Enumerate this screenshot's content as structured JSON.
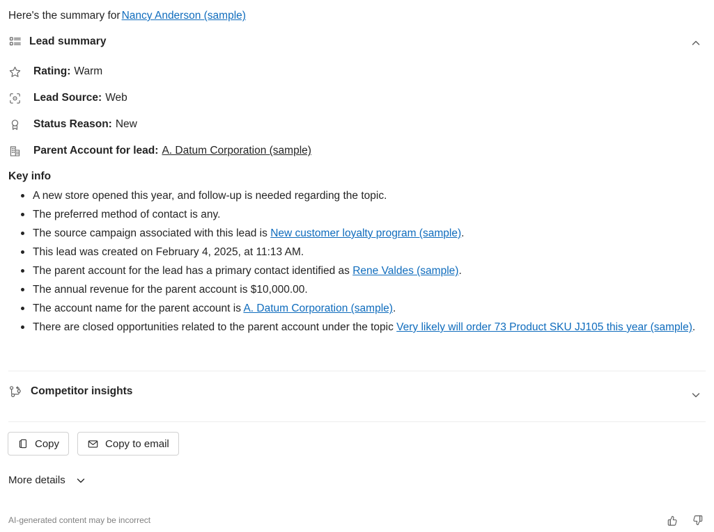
{
  "intro": {
    "prefix": "Here's the summary for",
    "subject_link": "Nancy Anderson (sample)"
  },
  "lead_summary": {
    "title": "Lead summary",
    "icon": "list-icon",
    "collapse_icon": "chevron-up-icon",
    "fields": [
      {
        "icon": "star-icon",
        "label": "Rating:",
        "value": "Warm",
        "is_link": false
      },
      {
        "icon": "target-icon",
        "label": "Lead Source:",
        "value": "Web",
        "is_link": false
      },
      {
        "icon": "ribbon-icon",
        "label": "Status Reason:",
        "value": "New",
        "is_link": false
      },
      {
        "icon": "building-icon",
        "label": "Parent Account for lead:",
        "value": "A. Datum Corporation (sample)",
        "is_link": true
      }
    ]
  },
  "key_info": {
    "title": "Key info",
    "bullets": [
      {
        "parts": [
          {
            "text": "A new store opened this year, and follow-up is needed regarding the topic.",
            "link": false
          }
        ]
      },
      {
        "parts": [
          {
            "text": "The preferred method of contact is any.",
            "link": false
          }
        ]
      },
      {
        "parts": [
          {
            "text": "The source campaign associated with this lead is ",
            "link": false
          },
          {
            "text": "New customer loyalty program (sample)",
            "link": true
          },
          {
            "text": ".",
            "link": false
          }
        ]
      },
      {
        "parts": [
          {
            "text": "This lead was created on February 4, 2025, at 11:13 AM.",
            "link": false
          }
        ]
      },
      {
        "parts": [
          {
            "text": "The parent account for the lead has a primary contact identified as ",
            "link": false
          },
          {
            "text": "Rene Valdes (sample)",
            "link": true
          },
          {
            "text": ".",
            "link": false
          }
        ]
      },
      {
        "parts": [
          {
            "text": "The annual revenue for the parent account is $10,000.00.",
            "link": false
          }
        ]
      },
      {
        "parts": [
          {
            "text": "The account name for the parent account is ",
            "link": false
          },
          {
            "text": "A. Datum Corporation (sample)",
            "link": true
          },
          {
            "text": ".",
            "link": false
          }
        ]
      },
      {
        "parts": [
          {
            "text": "There are closed opportunities related to the parent account under the topic ",
            "link": false
          },
          {
            "text": "Very likely will order 73 Product SKU JJ105 this year (sample)",
            "link": true
          },
          {
            "text": ".",
            "link": false
          }
        ]
      }
    ]
  },
  "competitor_insights": {
    "title": "Competitor insights",
    "icon": "branch-icon",
    "expand_icon": "chevron-down-icon"
  },
  "actions": {
    "copy": {
      "label": "Copy",
      "icon": "copy-icon"
    },
    "copy_to_email": {
      "label": "Copy to email",
      "icon": "envelope-icon"
    }
  },
  "more_details": {
    "label": "More details",
    "icon": "chevron-down-icon"
  },
  "footer": {
    "disclaimer": "AI-generated content may be incorrect",
    "thumbs_up_icon": "thumbs-up-icon",
    "thumbs_down_icon": "thumbs-down-icon"
  },
  "colors": {
    "link": "#0f6cbd",
    "text": "#242424",
    "muted": "#808080",
    "divider": "#ededed",
    "border": "#d1d1d1"
  }
}
